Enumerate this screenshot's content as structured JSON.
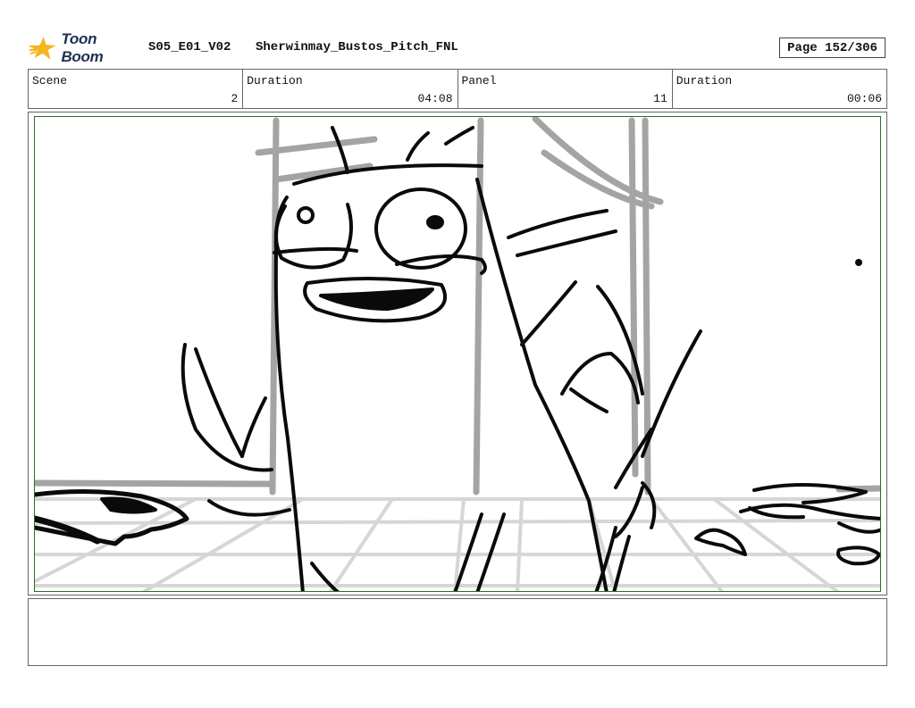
{
  "header": {
    "logo_text": "Toon Boom",
    "episode": "S05_E01_V02",
    "file_name": "Sherwinmay_Bustos_Pitch_FNL",
    "page": "Page 152/306"
  },
  "info": {
    "scene_label": "Scene",
    "scene_value": "2",
    "scene_duration_label": "Duration",
    "scene_duration_value": "04:08",
    "panel_label": "Panel",
    "panel_value": "11",
    "panel_duration_label": "Duration",
    "panel_duration_value": "00:06"
  },
  "colors": {
    "logo_star": "#f5b51e",
    "logo_text": "#1f2f52",
    "panel_border": "#2e6b2e"
  },
  "notes": {
    "text": ""
  }
}
